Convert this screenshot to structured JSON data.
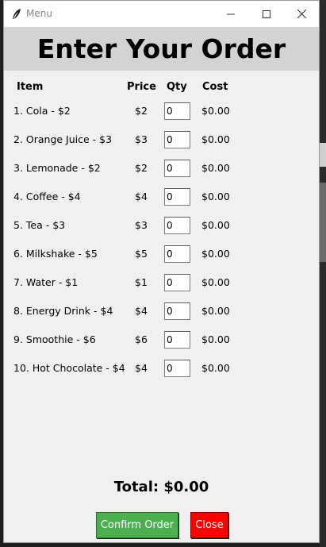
{
  "window": {
    "title": "Menu"
  },
  "header": {
    "title": "Enter Your Order"
  },
  "columns": {
    "item": "Item",
    "price": "Price",
    "qty": "Qty",
    "cost": "Cost"
  },
  "items": [
    {
      "label": "1. Cola - $2",
      "price": "$2",
      "qty": "0",
      "cost": "$0.00"
    },
    {
      "label": "2. Orange Juice - $3",
      "price": "$3",
      "qty": "0",
      "cost": "$0.00"
    },
    {
      "label": "3. Lemonade - $2",
      "price": "$2",
      "qty": "0",
      "cost": "$0.00"
    },
    {
      "label": "4. Coffee - $4",
      "price": "$4",
      "qty": "0",
      "cost": "$0.00"
    },
    {
      "label": "5. Tea - $3",
      "price": "$3",
      "qty": "0",
      "cost": "$0.00"
    },
    {
      "label": "6. Milkshake - $5",
      "price": "$5",
      "qty": "0",
      "cost": "$0.00"
    },
    {
      "label": "7. Water - $1",
      "price": "$1",
      "qty": "0",
      "cost": "$0.00"
    },
    {
      "label": "8. Energy Drink - $4",
      "price": "$4",
      "qty": "0",
      "cost": "$0.00"
    },
    {
      "label": "9. Smoothie - $6",
      "price": "$6",
      "qty": "0",
      "cost": "$0.00"
    },
    {
      "label": "10. Hot Chocolate - $4",
      "price": "$4",
      "qty": "0",
      "cost": "$0.00"
    }
  ],
  "total": {
    "label": "Total: $0.00"
  },
  "buttons": {
    "confirm_label": "Confirm Order",
    "close_label": "Close"
  },
  "colors": {
    "header_band": "#d3d3d3",
    "confirm_bg": "#4caf50",
    "close_bg": "#ff0000"
  },
  "icons": {
    "app": "feather-icon",
    "minimize": "minimize-icon",
    "maximize": "maximize-icon",
    "close": "close-icon"
  }
}
